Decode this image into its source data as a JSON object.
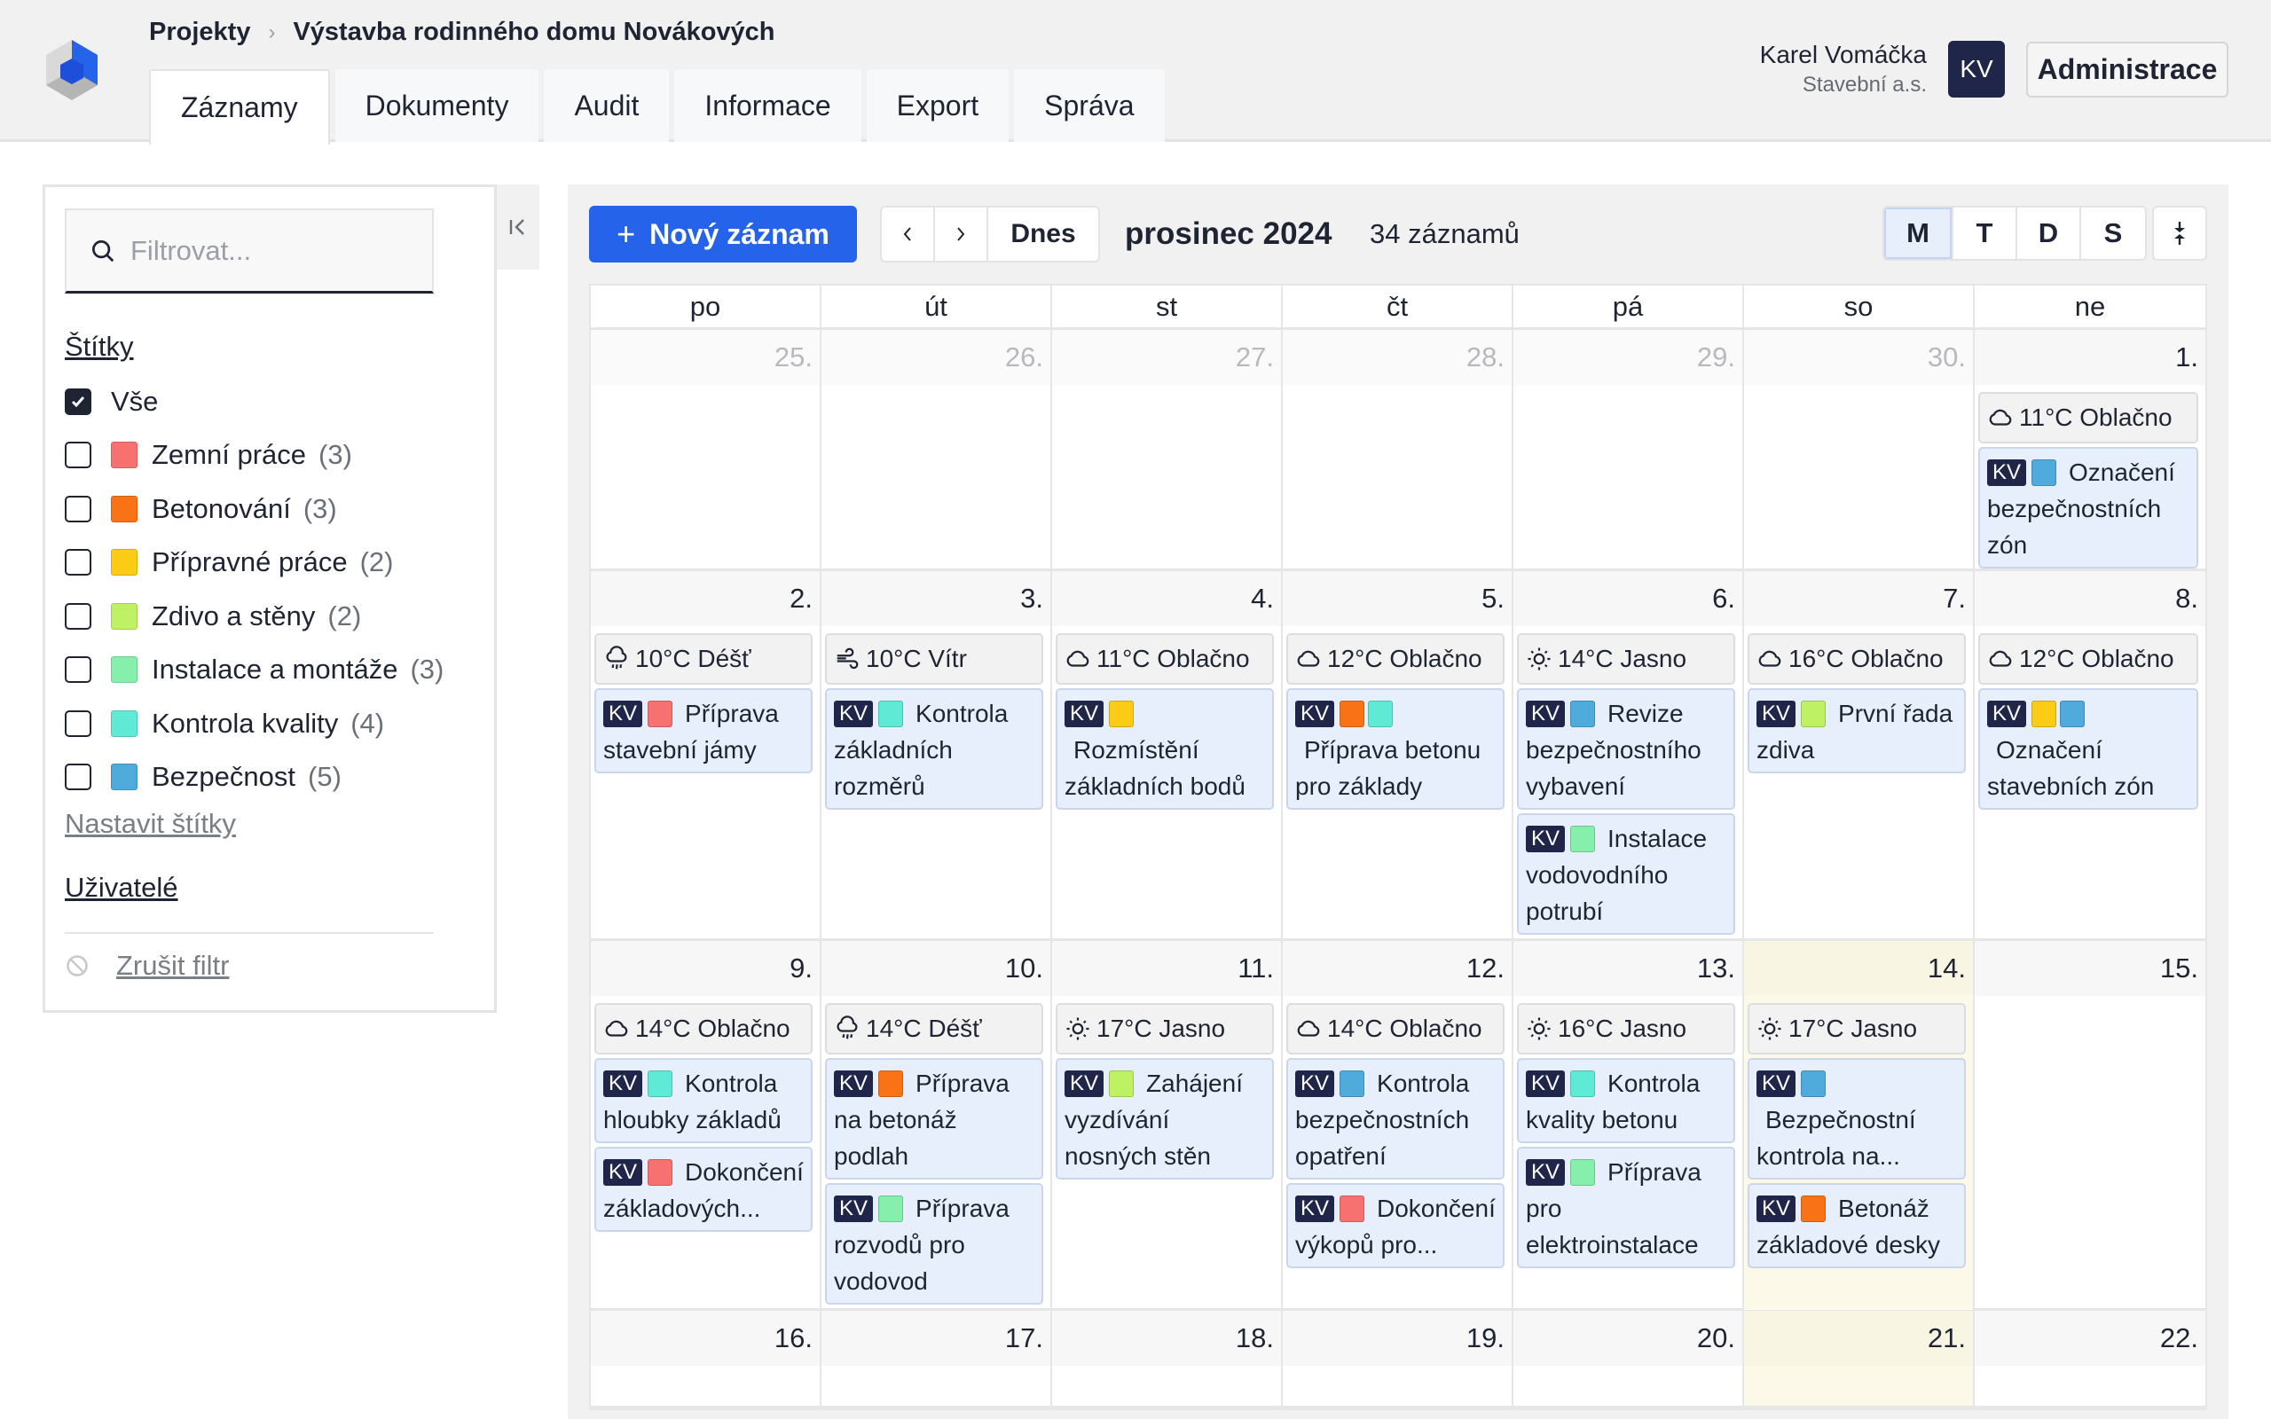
{
  "header": {
    "breadcrumb": [
      "Projekty",
      "Výstavba rodinného domu Novákových"
    ],
    "tabs": [
      {
        "label": "Záznamy",
        "active": true
      },
      {
        "label": "Dokumenty",
        "active": false
      },
      {
        "label": "Audit",
        "active": false
      },
      {
        "label": "Informace",
        "active": false
      },
      {
        "label": "Export",
        "active": false
      },
      {
        "label": "Správa",
        "active": false
      }
    ],
    "user_name": "Karel Vomáčka",
    "user_company": "Stavební a.s.",
    "user_initials": "KV",
    "admin_label": "Administrace"
  },
  "sidebar": {
    "filter_placeholder": "Filtrovat...",
    "filter_value": "",
    "tags_heading": "Štítky",
    "all_label": "Vše",
    "all_checked": true,
    "tags": [
      {
        "label": "Zemní práce",
        "count": "(3)",
        "color": "#f87171"
      },
      {
        "label": "Betonování",
        "count": "(3)",
        "color": "#f97316"
      },
      {
        "label": "Přípravné práce",
        "count": "(2)",
        "color": "#facc15"
      },
      {
        "label": "Zdivo a stěny",
        "count": "(2)",
        "color": "#bef264"
      },
      {
        "label": "Instalace a montáže",
        "count": "(3)",
        "color": "#86efac"
      },
      {
        "label": "Kontrola kvality",
        "count": "(4)",
        "color": "#5eead4"
      },
      {
        "label": "Bezpečnost",
        "count": "(5)",
        "color": "#4fabdc"
      }
    ],
    "configure_tags_label": "Nastavit štítky",
    "users_heading": "Uživatelé",
    "clear_filter_label": "Zrušit filtr"
  },
  "toolbar": {
    "new_record_label": "Nový záznam",
    "today_label": "Dnes",
    "month_title": "prosinec 2024",
    "record_count": "34 záznamů",
    "views": [
      {
        "label": "M",
        "active": true
      },
      {
        "label": "T",
        "active": false
      },
      {
        "label": "D",
        "active": false
      },
      {
        "label": "S",
        "active": false
      }
    ]
  },
  "calendar": {
    "weekdays": [
      "po",
      "út",
      "st",
      "čt",
      "pá",
      "so",
      "ne"
    ],
    "weeks": [
      [
        {
          "day": "25.",
          "other": true
        },
        {
          "day": "26.",
          "other": true
        },
        {
          "day": "27.",
          "other": true
        },
        {
          "day": "28.",
          "other": true
        },
        {
          "day": "29.",
          "other": true
        },
        {
          "day": "30.",
          "other": true
        },
        {
          "day": "1.",
          "weather": {
            "icon": "cloud",
            "text": "11°C Oblačno"
          },
          "events": [
            {
              "user": "KV",
              "tags": [
                "#4fabdc"
              ],
              "title": "Označení bezpečnostních zón"
            }
          ]
        }
      ],
      [
        {
          "day": "2.",
          "weather": {
            "icon": "rain",
            "text": "10°C Déšť"
          },
          "events": [
            {
              "user": "KV",
              "tags": [
                "#f87171"
              ],
              "title": "Příprava stavební jámy"
            }
          ]
        },
        {
          "day": "3.",
          "weather": {
            "icon": "wind",
            "text": "10°C Vítr"
          },
          "events": [
            {
              "user": "KV",
              "tags": [
                "#5eead4"
              ],
              "title": "Kontrola základních rozměrů"
            }
          ]
        },
        {
          "day": "4.",
          "weather": {
            "icon": "cloud",
            "text": "11°C Oblačno"
          },
          "events": [
            {
              "user": "KV",
              "tags": [
                "#facc15"
              ],
              "title": "Rozmístění základních bodů"
            }
          ]
        },
        {
          "day": "5.",
          "weather": {
            "icon": "cloud",
            "text": "12°C Oblačno"
          },
          "events": [
            {
              "user": "KV",
              "tags": [
                "#f97316",
                "#5eead4"
              ],
              "title": "Příprava betonu pro základy"
            }
          ]
        },
        {
          "day": "6.",
          "weather": {
            "icon": "sun",
            "text": "14°C Jasno"
          },
          "events": [
            {
              "user": "KV",
              "tags": [
                "#4fabdc"
              ],
              "title": "Revize bezpečnostního vybavení"
            },
            {
              "user": "KV",
              "tags": [
                "#86efac"
              ],
              "title": "Instalace vodovodního potrubí"
            }
          ]
        },
        {
          "day": "7.",
          "weather": {
            "icon": "cloud",
            "text": "16°C Oblačno"
          },
          "events": [
            {
              "user": "KV",
              "tags": [
                "#bef264"
              ],
              "title": "První řada zdiva"
            }
          ]
        },
        {
          "day": "8.",
          "weather": {
            "icon": "cloud",
            "text": "12°C Oblačno"
          },
          "events": [
            {
              "user": "KV",
              "tags": [
                "#facc15",
                "#4fabdc"
              ],
              "title": "Označení stavebních zón"
            }
          ]
        }
      ],
      [
        {
          "day": "9.",
          "weather": {
            "icon": "cloud",
            "text": "14°C Oblačno"
          },
          "events": [
            {
              "user": "KV",
              "tags": [
                "#5eead4"
              ],
              "title": "Kontrola hloubky základů"
            },
            {
              "user": "KV",
              "tags": [
                "#f87171"
              ],
              "title": "Dokončení základových..."
            }
          ]
        },
        {
          "day": "10.",
          "weather": {
            "icon": "rain",
            "text": "14°C Déšť"
          },
          "events": [
            {
              "user": "KV",
              "tags": [
                "#f97316"
              ],
              "title": "Příprava na betonáž podlah"
            },
            {
              "user": "KV",
              "tags": [
                "#86efac"
              ],
              "title": "Příprava rozvodů pro vodovod"
            }
          ]
        },
        {
          "day": "11.",
          "weather": {
            "icon": "sun",
            "text": "17°C Jasno"
          },
          "events": [
            {
              "user": "KV",
              "tags": [
                "#bef264"
              ],
              "title": "Zahájení vyzdívání nosných stěn"
            }
          ]
        },
        {
          "day": "12.",
          "weather": {
            "icon": "cloud",
            "text": "14°C Oblačno"
          },
          "events": [
            {
              "user": "KV",
              "tags": [
                "#4fabdc"
              ],
              "title": "Kontrola bezpečnostních opatření"
            },
            {
              "user": "KV",
              "tags": [
                "#f87171"
              ],
              "title": "Dokončení výkopů pro..."
            }
          ]
        },
        {
          "day": "13.",
          "weather": {
            "icon": "sun",
            "text": "16°C Jasno"
          },
          "events": [
            {
              "user": "KV",
              "tags": [
                "#5eead4"
              ],
              "title": "Kontrola kvality betonu"
            },
            {
              "user": "KV",
              "tags": [
                "#86efac"
              ],
              "title": "Příprava pro elektroinstalace"
            }
          ]
        },
        {
          "day": "14.",
          "today": true,
          "weather": {
            "icon": "sun",
            "text": "17°C Jasno"
          },
          "events": [
            {
              "user": "KV",
              "tags": [
                "#4fabdc"
              ],
              "title": "Bezpečnostní kontrola na..."
            },
            {
              "user": "KV",
              "tags": [
                "#f97316"
              ],
              "title": "Betonáž základové desky"
            }
          ]
        },
        {
          "day": "15."
        }
      ],
      [
        {
          "day": "16."
        },
        {
          "day": "17."
        },
        {
          "day": "18."
        },
        {
          "day": "19."
        },
        {
          "day": "20."
        },
        {
          "day": "21.",
          "today": true
        },
        {
          "day": "22."
        }
      ]
    ]
  }
}
